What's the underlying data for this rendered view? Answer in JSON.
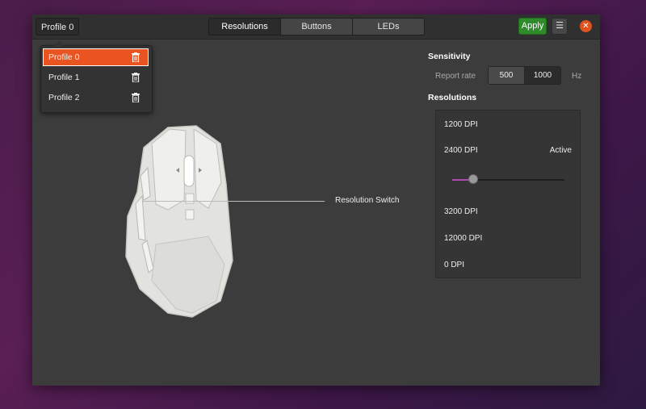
{
  "header": {
    "profile_button": "Profile 0",
    "tabs": [
      {
        "label": "Resolutions",
        "active": true
      },
      {
        "label": "Buttons",
        "active": false
      },
      {
        "label": "LEDs",
        "active": false
      }
    ],
    "apply_label": "Apply",
    "menu_icon": "hamburger-icon",
    "close_icon": "close-icon"
  },
  "profiles": {
    "items": [
      {
        "label": "Profile 0",
        "selected": true
      },
      {
        "label": "Profile 1",
        "selected": false
      },
      {
        "label": "Profile 2",
        "selected": false
      }
    ],
    "delete_icon": "trash-icon"
  },
  "sensitivity": {
    "title": "Sensitivity",
    "report_rate_label": "Report rate",
    "options": [
      "500",
      "1000"
    ],
    "selected": "1000",
    "unit": "Hz"
  },
  "resolutions": {
    "title": "Resolutions",
    "items": [
      {
        "label": "1200 DPI"
      },
      {
        "label": "2400 DPI",
        "status": "Active",
        "slider_fraction": 0.19
      },
      {
        "label": "3200 DPI"
      },
      {
        "label": "12000 DPI"
      },
      {
        "label": "0 DPI"
      }
    ]
  },
  "device": {
    "callout_label": "Resolution Switch"
  },
  "colors": {
    "accent": "#e95420",
    "apply": "#2f8a2c",
    "slider_fill": "#b04ab0"
  }
}
